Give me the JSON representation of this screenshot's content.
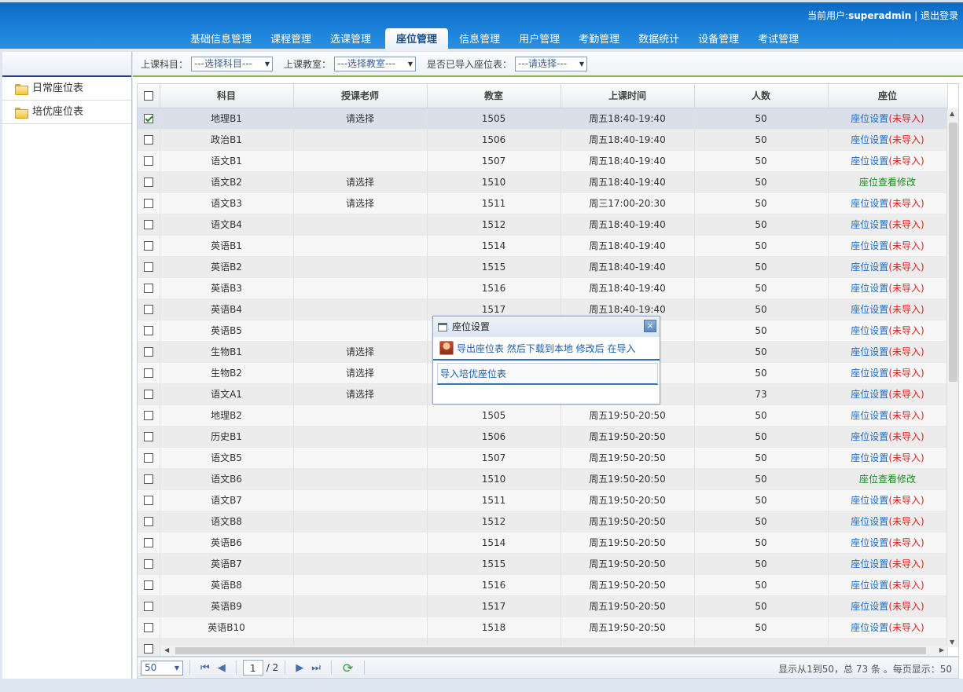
{
  "header": {
    "user_prefix": "当前用户:",
    "username": "superadmin",
    "separator": " | ",
    "logout": "退出登录"
  },
  "nav": [
    "基础信息管理",
    "课程管理",
    "选课管理",
    "座位管理",
    "信息管理",
    "用户管理",
    "考勤管理",
    "数据统计",
    "设备管理",
    "考试管理"
  ],
  "nav_active": "座位管理",
  "sidebar": {
    "items": [
      "日常座位表",
      "培优座位表"
    ]
  },
  "filters": {
    "subject_label": "上课科目：",
    "subject_value": "---选择科目---",
    "room_label": "上课教室：",
    "room_value": "---选择教室---",
    "imported_label": "是否已导入座位表：",
    "imported_value": "---请选择---"
  },
  "table": {
    "columns": [
      "科目",
      "授课老师",
      "教室",
      "上课时间",
      "人数",
      "座位"
    ],
    "link_text": "座位设置",
    "link_suffix": "(未导入)",
    "view_text": "座位查看修改",
    "rows": [
      {
        "subject": "地理B1",
        "teacher": "请选择",
        "room": "1505",
        "time": "周五18:40-19:40",
        "count": "50",
        "seat": "set",
        "checked": true
      },
      {
        "subject": "政治B1",
        "teacher": "",
        "room": "1506",
        "time": "周五18:40-19:40",
        "count": "50",
        "seat": "set"
      },
      {
        "subject": "语文B1",
        "teacher": "",
        "room": "1507",
        "time": "周五18:40-19:40",
        "count": "50",
        "seat": "set"
      },
      {
        "subject": "语文B2",
        "teacher": "请选择",
        "room": "1510",
        "time": "周五18:40-19:40",
        "count": "50",
        "seat": "view"
      },
      {
        "subject": "语文B3",
        "teacher": "请选择",
        "room": "1511",
        "time": "周三17:00-20:30",
        "count": "50",
        "seat": "set"
      },
      {
        "subject": "语文B4",
        "teacher": "",
        "room": "1512",
        "time": "周五18:40-19:40",
        "count": "50",
        "seat": "set"
      },
      {
        "subject": "英语B1",
        "teacher": "",
        "room": "1514",
        "time": "周五18:40-19:40",
        "count": "50",
        "seat": "set"
      },
      {
        "subject": "英语B2",
        "teacher": "",
        "room": "1515",
        "time": "周五18:40-19:40",
        "count": "50",
        "seat": "set"
      },
      {
        "subject": "英语B3",
        "teacher": "",
        "room": "1516",
        "time": "周五18:40-19:40",
        "count": "50",
        "seat": "set"
      },
      {
        "subject": "英语B4",
        "teacher": "",
        "room": "1517",
        "time": "周五18:40-19:40",
        "count": "50",
        "seat": "set"
      },
      {
        "subject": "英语B5",
        "teacher": "",
        "room": "",
        "time": "",
        "count": "50",
        "seat": "set"
      },
      {
        "subject": "生物B1",
        "teacher": "请选择",
        "room": "",
        "time": "",
        "count": "50",
        "seat": "set"
      },
      {
        "subject": "生物B2",
        "teacher": "请选择",
        "room": "",
        "time": "",
        "count": "50",
        "seat": "set"
      },
      {
        "subject": "语文A1",
        "teacher": "请选择",
        "room": "",
        "time": "",
        "count": "73",
        "seat": "set"
      },
      {
        "subject": "地理B2",
        "teacher": "",
        "room": "1505",
        "time": "周五19:50-20:50",
        "count": "50",
        "seat": "set"
      },
      {
        "subject": "历史B1",
        "teacher": "",
        "room": "1506",
        "time": "周五19:50-20:50",
        "count": "50",
        "seat": "set"
      },
      {
        "subject": "语文B5",
        "teacher": "",
        "room": "1507",
        "time": "周五19:50-20:50",
        "count": "50",
        "seat": "set"
      },
      {
        "subject": "语文B6",
        "teacher": "",
        "room": "1510",
        "time": "周五19:50-20:50",
        "count": "50",
        "seat": "view"
      },
      {
        "subject": "语文B7",
        "teacher": "",
        "room": "1511",
        "time": "周五19:50-20:50",
        "count": "50",
        "seat": "set"
      },
      {
        "subject": "语文B8",
        "teacher": "",
        "room": "1512",
        "time": "周五19:50-20:50",
        "count": "50",
        "seat": "set"
      },
      {
        "subject": "英语B6",
        "teacher": "",
        "room": "1514",
        "time": "周五19:50-20:50",
        "count": "50",
        "seat": "set"
      },
      {
        "subject": "英语B7",
        "teacher": "",
        "room": "1515",
        "time": "周五19:50-20:50",
        "count": "50",
        "seat": "set"
      },
      {
        "subject": "英语B8",
        "teacher": "",
        "room": "1516",
        "time": "周五19:50-20:50",
        "count": "50",
        "seat": "set"
      },
      {
        "subject": "英语B9",
        "teacher": "",
        "room": "1517",
        "time": "周五19:50-20:50",
        "count": "50",
        "seat": "set"
      },
      {
        "subject": "英语B10",
        "teacher": "",
        "room": "1518",
        "time": "周五19:50-20:50",
        "count": "50",
        "seat": "set"
      },
      {
        "subject": "",
        "teacher": "",
        "room": "",
        "time": "",
        "count": "",
        "seat": "none"
      }
    ]
  },
  "pager": {
    "page_size": "50",
    "current_page": "1",
    "total_pages": "/ 2",
    "info": "显示从1到50，总 73 条 。每页显示：50"
  },
  "dialog": {
    "title": "座位设置",
    "export_text": "导出座位表 然后下载到本地 修改后 在导入",
    "import_text": "导入培优座位表",
    "close": "×"
  }
}
